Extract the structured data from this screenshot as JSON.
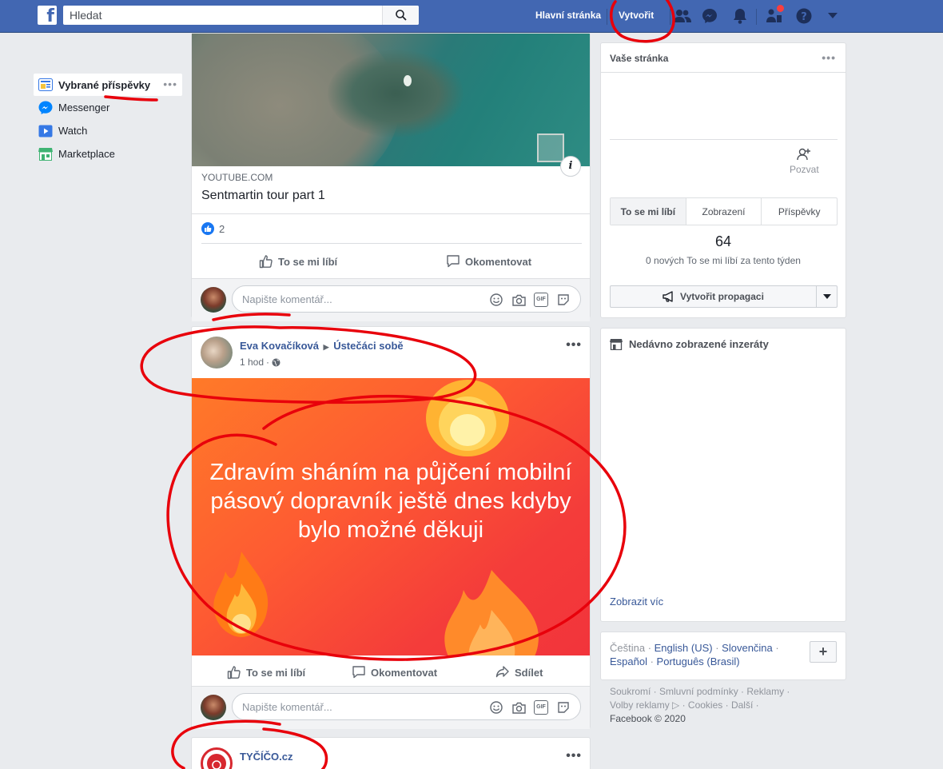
{
  "topbar": {
    "search_placeholder": "Hledat",
    "home_label": "Hlavní stránka",
    "create_label": "Vytvořit"
  },
  "sidebar": {
    "items": [
      {
        "label": "Vybrané příspěvky",
        "icon": "news-feed-icon"
      },
      {
        "label": "Messenger",
        "icon": "messenger-icon"
      },
      {
        "label": "Watch",
        "icon": "watch-icon"
      },
      {
        "label": "Marketplace",
        "icon": "marketplace-icon"
      }
    ]
  },
  "feed": {
    "link_post": {
      "source": "YOUTUBE.COM",
      "title": "Sentmartin tour part 1",
      "like_count": "2",
      "like_label": "To se mi líbí",
      "comment_label": "Okomentovat",
      "comment_placeholder": "Napište komentář..."
    },
    "text_post": {
      "author": "Eva Kovačíková",
      "group": "Ústečáci sobě",
      "time": "1 hod",
      "body": "Zdravím sháním na půjčení mobilní pásový dopravník ještě dnes kdyby bylo možné děkuji",
      "like_label": "To se mi líbí",
      "comment_label": "Okomentovat",
      "share_label": "Sdílet",
      "comment_placeholder": "Napište komentář...",
      "bg_color": "#fe5b32"
    },
    "next_post": {
      "author": "TYČÍČO.cz"
    }
  },
  "right": {
    "page_card": {
      "title": "Vaše stránka",
      "invite_label": "Pozvat",
      "tabs": [
        "To se mi líbí",
        "Zobrazení",
        "Příspěvky"
      ],
      "likes_count": "64",
      "likes_sub": "0 nových To se mi líbí za tento týden",
      "promo_label": "Vytvořit propagaci"
    },
    "ads_card": {
      "title": "Nedávno zobrazené inzeráty",
      "see_more": "Zobrazit víc"
    },
    "languages": {
      "current": "Čeština",
      "others": [
        "English (US)",
        "Slovenčina",
        "Español",
        "Português (Brasil)"
      ]
    },
    "footer": {
      "line1": "Soukromí · Smluvní podmínky · Reklamy ·",
      "line2": "Volby reklamy ▷ · Cookies · Další ·",
      "copyright": "Facebook © 2020"
    }
  },
  "colors": {
    "brand": "#4267b2",
    "link": "#385898",
    "annotation": "#e8000b"
  }
}
